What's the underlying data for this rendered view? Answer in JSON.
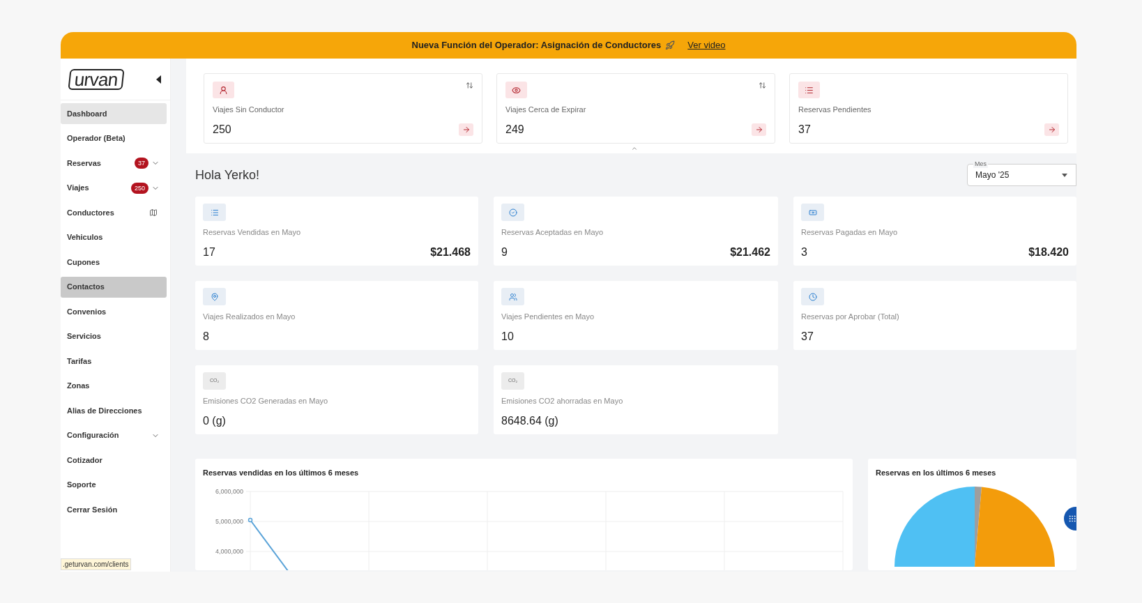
{
  "banner": {
    "text": "Nueva Función del Operador: Asignación de Conductores",
    "link": "Ver video"
  },
  "sidebar": {
    "logo": "urvan",
    "items": [
      {
        "label": "Dashboard",
        "kind": "plain",
        "selected": true,
        "highlighted": false,
        "expandable": false
      },
      {
        "label": "Operador (Beta)",
        "kind": "plain",
        "selected": false,
        "highlighted": false,
        "expandable": false
      },
      {
        "label": "Reservas",
        "kind": "plain",
        "badge": "37",
        "selected": false,
        "highlighted": false,
        "expandable": true
      },
      {
        "label": "Viajes",
        "kind": "plain",
        "badge": "250",
        "selected": false,
        "highlighted": false,
        "expandable": true
      },
      {
        "label": "Conductores",
        "kind": "map",
        "selected": false,
        "highlighted": false,
        "expandable": false
      },
      {
        "label": "Vehiculos",
        "kind": "plain",
        "selected": false,
        "highlighted": false,
        "expandable": false
      },
      {
        "label": "Cupones",
        "kind": "plain",
        "selected": false,
        "highlighted": false,
        "expandable": false
      },
      {
        "label": "Contactos",
        "kind": "plain",
        "selected": false,
        "highlighted": true,
        "expandable": false
      },
      {
        "label": "Convenios",
        "kind": "plain",
        "selected": false,
        "highlighted": false,
        "expandable": false
      },
      {
        "label": "Servicios",
        "kind": "plain",
        "selected": false,
        "highlighted": false,
        "expandable": false
      },
      {
        "label": "Tarifas",
        "kind": "plain",
        "selected": false,
        "highlighted": false,
        "expandable": false
      },
      {
        "label": "Zonas",
        "kind": "plain",
        "selected": false,
        "highlighted": false,
        "expandable": false
      },
      {
        "label": "Alias de Direcciones",
        "kind": "plain",
        "selected": false,
        "highlighted": false,
        "expandable": false
      },
      {
        "label": "Configuración",
        "kind": "plain",
        "selected": false,
        "highlighted": false,
        "expandable": true
      },
      {
        "label": "Cotizador",
        "kind": "plain",
        "selected": false,
        "highlighted": false,
        "expandable": false
      },
      {
        "label": "Soporte",
        "kind": "plain",
        "selected": false,
        "highlighted": false,
        "expandable": false
      },
      {
        "label": "Cerrar Sesión",
        "kind": "plain",
        "selected": false,
        "highlighted": false,
        "expandable": false
      }
    ],
    "status_url": ".geturvan.com/clients"
  },
  "alert_cards": [
    {
      "kind": "user",
      "label": "Viajes Sin Conductor",
      "value": "250",
      "sortable": true
    },
    {
      "kind": "eye",
      "label": "Viajes Cerca de Expirar",
      "value": "249",
      "sortable": true
    },
    {
      "kind": "list",
      "label": "Reservas Pendientes",
      "value": "37",
      "sortable": false
    }
  ],
  "greeting": "Hola Yerko!",
  "month_select": {
    "label": "Mes",
    "value": "Mayo '25"
  },
  "stats": [
    {
      "kind": "list",
      "label": "Reservas Vendidas en Mayo",
      "value": "17",
      "amount": "$21.468"
    },
    {
      "kind": "check",
      "label": "Reservas Aceptadas en Mayo",
      "value": "9",
      "amount": "$21.462"
    },
    {
      "kind": "cash",
      "label": "Reservas Pagadas en Mayo",
      "value": "3",
      "amount": "$18.420"
    },
    {
      "kind": "pin",
      "label": "Viajes Realizados en Mayo",
      "value": "8"
    },
    {
      "kind": "users",
      "label": "Viajes Pendientes en Mayo",
      "value": "10"
    },
    {
      "kind": "clock",
      "label": "Reservas por Aprobar (Total)",
      "value": "37"
    },
    {
      "kind": "co2",
      "icon_text": "CO₂",
      "label": "Emisiones CO2 Generadas en Mayo",
      "value": "0 (g)"
    },
    {
      "kind": "co2",
      "icon_text": "CO₂",
      "label": "Emisiones CO2 ahorradas en Mayo",
      "value": "8648.64 (g)"
    }
  ],
  "line_chart": {
    "title": "Reservas vendidas en los últimos 6 meses",
    "axis_labels": [
      "6,000,000",
      "5,000,000",
      "4,000,000"
    ]
  },
  "pie_card": {
    "title": "Reservas en los últimos 6 meses"
  }
}
